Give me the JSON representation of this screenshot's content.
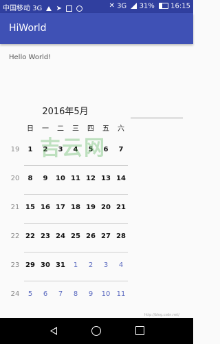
{
  "status_bar": {
    "carrier": "中国移动 3G",
    "network": "3G",
    "battery": "31%",
    "time": "16:15"
  },
  "app_bar": {
    "title": "HiWorld"
  },
  "content": {
    "hello": "Hello World!"
  },
  "calendar": {
    "month_title": "2016年5月",
    "weekdays": [
      "日",
      "一",
      "二",
      "三",
      "四",
      "五",
      "六"
    ],
    "weeks": [
      {
        "num": "19",
        "days": [
          {
            "d": "1",
            "t": "cur"
          },
          {
            "d": "2",
            "t": "cur"
          },
          {
            "d": "3",
            "t": "cur"
          },
          {
            "d": "4",
            "t": "cur"
          },
          {
            "d": "5",
            "t": "cur"
          },
          {
            "d": "6",
            "t": "cur"
          },
          {
            "d": "7",
            "t": "cur"
          }
        ]
      },
      {
        "num": "20",
        "days": [
          {
            "d": "8",
            "t": "cur"
          },
          {
            "d": "9",
            "t": "cur"
          },
          {
            "d": "10",
            "t": "cur"
          },
          {
            "d": "11",
            "t": "cur"
          },
          {
            "d": "12",
            "t": "cur"
          },
          {
            "d": "13",
            "t": "cur"
          },
          {
            "d": "14",
            "t": "cur"
          }
        ]
      },
      {
        "num": "21",
        "days": [
          {
            "d": "15",
            "t": "cur"
          },
          {
            "d": "16",
            "t": "cur"
          },
          {
            "d": "17",
            "t": "cur"
          },
          {
            "d": "18",
            "t": "cur"
          },
          {
            "d": "19",
            "t": "cur"
          },
          {
            "d": "20",
            "t": "cur"
          },
          {
            "d": "21",
            "t": "cur"
          }
        ]
      },
      {
        "num": "22",
        "days": [
          {
            "d": "22",
            "t": "cur"
          },
          {
            "d": "23",
            "t": "cur"
          },
          {
            "d": "24",
            "t": "cur"
          },
          {
            "d": "25",
            "t": "cur"
          },
          {
            "d": "26",
            "t": "cur"
          },
          {
            "d": "27",
            "t": "cur"
          },
          {
            "d": "28",
            "t": "cur"
          }
        ]
      },
      {
        "num": "23",
        "days": [
          {
            "d": "29",
            "t": "cur"
          },
          {
            "d": "30",
            "t": "cur"
          },
          {
            "d": "31",
            "t": "cur"
          },
          {
            "d": "1",
            "t": "next"
          },
          {
            "d": "2",
            "t": "next"
          },
          {
            "d": "3",
            "t": "next"
          },
          {
            "d": "4",
            "t": "next"
          }
        ]
      },
      {
        "num": "24",
        "days": [
          {
            "d": "5",
            "t": "next"
          },
          {
            "d": "6",
            "t": "next"
          },
          {
            "d": "7",
            "t": "next"
          },
          {
            "d": "8",
            "t": "next"
          },
          {
            "d": "9",
            "t": "next"
          },
          {
            "d": "10",
            "t": "next"
          },
          {
            "d": "11",
            "t": "next"
          }
        ]
      }
    ]
  },
  "watermark": {
    "text": "吉云网",
    "url": "http://blog.csdn.net/"
  },
  "nav_bar": {
    "back_icon": "back-triangle",
    "home_icon": "home-circle",
    "recent_icon": "recents-square"
  }
}
